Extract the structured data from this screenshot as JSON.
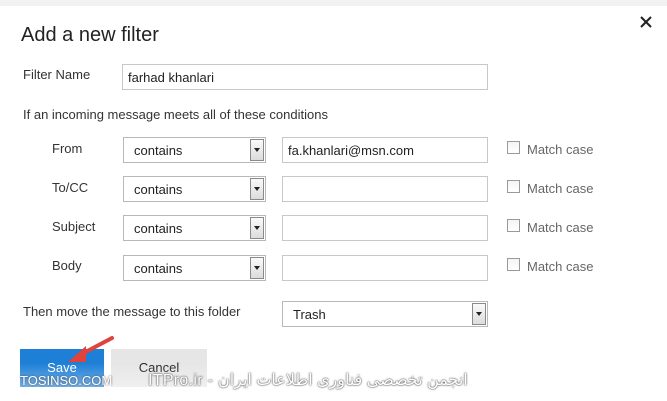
{
  "dialog": {
    "title": "Add a new filter",
    "filter_name_label": "Filter Name",
    "filter_name_value": "farhad khanlari",
    "conditions_text": "If an incoming message meets all of these conditions",
    "conditions": [
      {
        "label": "From",
        "operator": "contains",
        "value": "fa.khanlari@msn.com",
        "match_case": "Match case",
        "checked": false
      },
      {
        "label": "To/CC",
        "operator": "contains",
        "value": "",
        "match_case": "Match case",
        "checked": false
      },
      {
        "label": "Subject",
        "operator": "contains",
        "value": "",
        "match_case": "Match case",
        "checked": false
      },
      {
        "label": "Body",
        "operator": "contains",
        "value": "",
        "match_case": "Match case",
        "checked": false
      }
    ],
    "move_label": "Then move the message to this folder",
    "folder_value": "Trash",
    "save_label": "Save",
    "cancel_label": "Cancel"
  },
  "watermark": {
    "left_text": "TOSINSO.COM",
    "right_text": "ITPro.ir - انجمن تخصصی فناوری اطلاعات ایران"
  },
  "annotation": {
    "arrow_color": "#e0433b"
  },
  "icons": {
    "close": "close-icon",
    "dropdown": "chevron-down-icon"
  }
}
